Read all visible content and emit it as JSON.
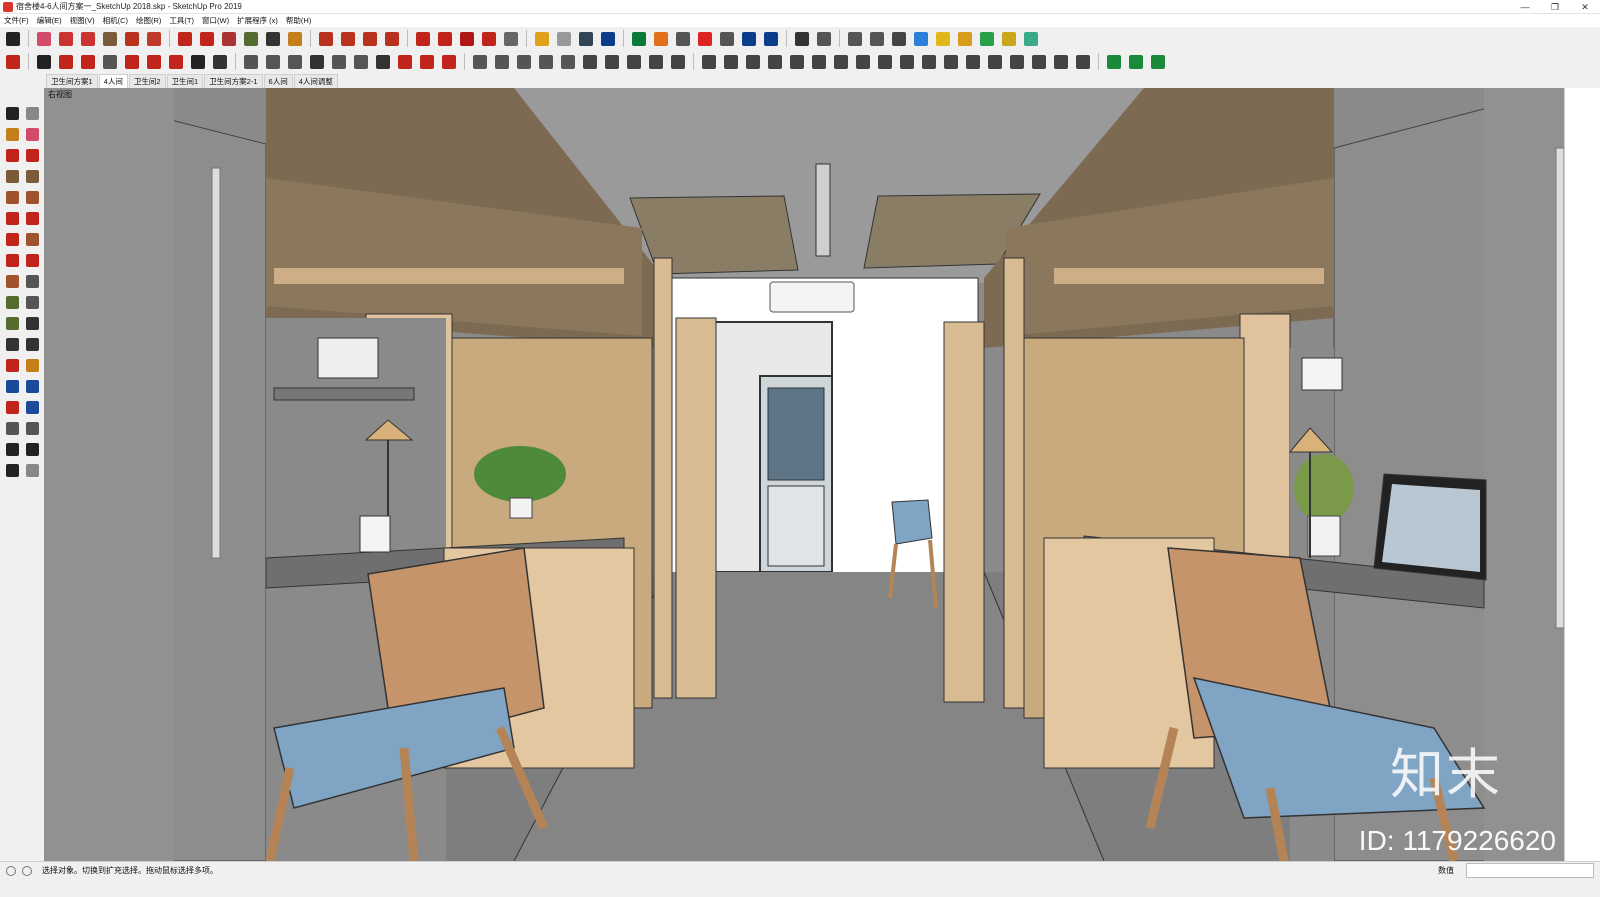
{
  "window": {
    "title": "宿舍楼4-6人间方案一_SketchUp 2018.skp - SketchUp Pro 2019",
    "minimize": "—",
    "restore": "❐",
    "close": "✕"
  },
  "menu": [
    "文件(F)",
    "编辑(E)",
    "视图(V)",
    "相机(C)",
    "绘图(R)",
    "工具(T)",
    "窗口(W)",
    "扩展程序 (x)",
    "帮助(H)"
  ],
  "toolbar1": {
    "icons": [
      "select-icon",
      "eraser-icon",
      "pencil-icon",
      "arc-icon",
      "rectangle-icon",
      "push-pull-icon",
      "follow-me-icon",
      "move-icon",
      "rotate-icon",
      "scale-icon",
      "tape-measure-icon",
      "text-icon",
      "paint-bucket-icon",
      "orbit-icon",
      "pan-icon",
      "zoom-icon",
      "zoom-extents-icon",
      "warehouse-icon",
      "extension-icon",
      "components-icon",
      "ruby-icon",
      "user-icon",
      "undo-icon",
      "refresh-icon",
      "layers-icon",
      "plus-circle-icon",
      "house-icon",
      "materials-icon",
      "checker-icon",
      "cloud-icon",
      "settings-icon",
      "mail-icon",
      "info-icon",
      "person-icon",
      "scene-icon",
      "camera-icon",
      "cloud-up-icon",
      "link-icon",
      "rotate-3d-icon",
      "select-tool-icon",
      "dimension-icon",
      "axes-icon",
      "walk-icon",
      "person-solid-icon"
    ],
    "colors": [
      "#222222",
      "#d44a6a",
      "#c33",
      "#c33",
      "#7a5c3a",
      "#b8321e",
      "#c0392b",
      "#c0241a",
      "#c0241a",
      "#a33",
      "#556b2f",
      "#333",
      "#c47f1a",
      "#b8321e",
      "#b8321e",
      "#b8321e",
      "#b8321e",
      "#c0241a",
      "#c0241a",
      "#b01818",
      "#c0241a",
      "#666",
      "#e0a01a",
      "#999",
      "#345",
      "#0a3d8a",
      "#0a7a3a",
      "#e2701a",
      "#555",
      "#d22",
      "#555",
      "#0a3d8a",
      "#0a3d8a",
      "#333",
      "#555",
      "#555",
      "#555",
      "#444",
      "#2a7fd8",
      "#e0b81a",
      "#d89b1a",
      "#2aa04a",
      "#c8a81a",
      "#3aaa8a"
    ]
  },
  "toolbar2": {
    "icons": [
      "move-red-icon",
      "copy-icon",
      "curve-icon",
      "bezier-icon",
      "joint-icon",
      "box-icon",
      "box2-icon",
      "box3-icon",
      "cut-icon",
      "gear-icon",
      "sphere-icon",
      "hook-icon",
      "mirror-icon",
      "polygon-icon",
      "chain-icon",
      "spring-icon",
      "split-icon",
      "corner-icon",
      "corner2-icon",
      "line-icon",
      "curve2-icon",
      "house2-icon",
      "cone-icon",
      "bowl-icon",
      "box4-icon",
      "zigzag-icon",
      "wall-icon",
      "grid-icon",
      "grass-icon",
      "leaf-icon",
      "loft-icon",
      "frame-icon",
      "arrow-down-icon",
      "sweep-icon",
      "twist-icon",
      "fold-icon",
      "bend-icon",
      "stair-icon",
      "block-icon",
      "mesh-icon",
      "ribbon-icon",
      "shell-icon",
      "stripes-icon",
      "hatch-icon",
      "weave-icon",
      "panel-icon",
      "fence-icon",
      "plate-icon",
      "green-box-icon",
      "green-cube-icon",
      "green-layer-icon"
    ],
    "colors": [
      "#c0241a",
      "#222",
      "#c0241a",
      "#c0241a",
      "#555",
      "#c0241a",
      "#c0241a",
      "#c0241a",
      "#222",
      "#333",
      "#555",
      "#555",
      "#555",
      "#333",
      "#555",
      "#555",
      "#333",
      "#c0241a",
      "#c0241a",
      "#c0241a",
      "#555",
      "#555",
      "#555",
      "#555",
      "#555",
      "#444",
      "#444",
      "#444",
      "#444",
      "#444",
      "#444",
      "#444",
      "#444",
      "#444",
      "#444",
      "#444",
      "#444",
      "#444",
      "#444",
      "#444",
      "#444",
      "#444",
      "#444",
      "#444",
      "#444",
      "#444",
      "#444",
      "#444",
      "#1a8a3a",
      "#1a8a3a",
      "#1a8a3a"
    ]
  },
  "scene_tabs": [
    {
      "label": "卫生间方案1",
      "active": false
    },
    {
      "label": "4人间",
      "active": true
    },
    {
      "label": "卫生间2",
      "active": false
    },
    {
      "label": "卫生间1",
      "active": false
    },
    {
      "label": "卫生间方案2-1",
      "active": false
    },
    {
      "label": "6人间",
      "active": false
    },
    {
      "label": "4人间调整",
      "active": false
    }
  ],
  "left_palette": {
    "icons": [
      [
        "select-icon",
        "component-icon"
      ],
      [
        "paint-bucket-icon",
        "eraser-icon"
      ],
      [
        "line-icon",
        "freehand-icon"
      ],
      [
        "rectangle-icon",
        "rotated-rectangle-icon"
      ],
      [
        "circle-icon",
        "polygon-icon"
      ],
      [
        "arc-icon",
        "two-point-arc-icon"
      ],
      [
        "three-point-arc-icon",
        "pie-icon"
      ],
      [
        "move-icon",
        "push-pull-icon"
      ],
      [
        "rotate-icon",
        "follow-me-icon"
      ],
      [
        "scale-icon",
        "offset-icon"
      ],
      [
        "tape-measure-icon",
        "dimension-icon"
      ],
      [
        "protractor-icon",
        "text-icon"
      ],
      [
        "axes-icon",
        "3d-text-icon"
      ],
      [
        "orbit-icon",
        "pan-icon"
      ],
      [
        "zoom-icon",
        "zoom-window-icon"
      ],
      [
        "zoom-extents-icon",
        "zoom-selection-icon"
      ],
      [
        "position-camera-icon",
        "look-around-icon"
      ],
      [
        "walk-icon",
        "section-plane-icon"
      ]
    ],
    "colors": [
      "#222",
      "#888",
      "#c47f1a",
      "#d44a6a",
      "#c0241a",
      "#c0241a",
      "#7a5c3a",
      "#7a5c3a",
      "#a0522d",
      "#a0522d",
      "#c0241a",
      "#c0241a",
      "#c0241a",
      "#a0522d",
      "#c0241a",
      "#c0241a",
      "#a0522d",
      "#555",
      "#556b2f",
      "#555",
      "#556b2f",
      "#333",
      "#333",
      "#333",
      "#c0241a",
      "#c47f1a",
      "#1a4a9a",
      "#1a4a9a",
      "#c0241a",
      "#1a4a9a",
      "#555",
      "#555",
      "#222",
      "#222"
    ]
  },
  "viewport": {
    "view_label": "右视图"
  },
  "watermark": {
    "logo_text": "知末",
    "id_text": "ID: 1179226620"
  },
  "status": {
    "message": "选择对象。切换到扩充选择。拖动鼠标选择多项。",
    "measure_label": "数值",
    "measure_value": ""
  }
}
